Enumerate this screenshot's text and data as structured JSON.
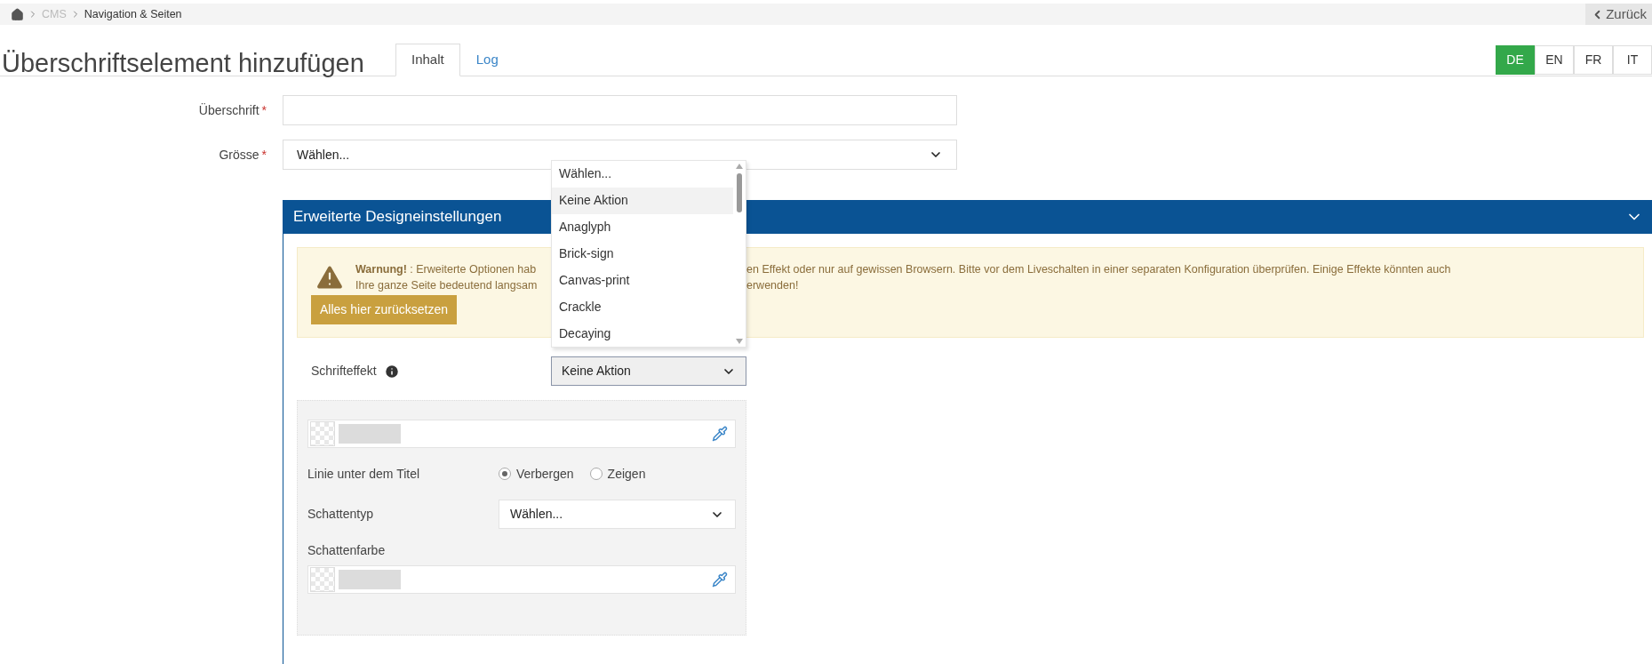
{
  "breadcrumb": {
    "items": [
      {
        "label": "CMS",
        "current": false
      },
      {
        "label": "Navigation & Seiten",
        "current": true
      }
    ],
    "back": "Zurück"
  },
  "title": "Überschriftselement hinzufügen",
  "tabs": [
    {
      "label": "Inhalt",
      "selected": true
    },
    {
      "label": "Log",
      "selected": false
    }
  ],
  "languages": [
    {
      "label": "DE",
      "selected": true
    },
    {
      "label": "EN",
      "selected": false
    },
    {
      "label": "FR",
      "selected": false
    },
    {
      "label": "IT",
      "selected": false
    }
  ],
  "fields": [
    {
      "kind": "text",
      "label": "Überschrift",
      "required_mark": "*"
    },
    {
      "kind": "select",
      "label": "Grösse",
      "required_mark": "*",
      "value": "Wählen..."
    }
  ],
  "panel": {
    "title": "Erweiterte Designeinstellungen",
    "expanded": true,
    "warning": {
      "lines": [
        {
          "left": "**Warnung!** : Erweiterte Optionen hab",
          "right": "en Effekt oder nur auf gewissen Browsern. Bitte vor dem Liveschalten in einer separaten Konfiguration überprüfen. Einige Effekte könnten auch"
        },
        {
          "left": "Ihre ganze Seite bedeutend langsam",
          "right": "erwenden!"
        }
      ],
      "button": "Alles hier zurücksetzen"
    },
    "font_effect": {
      "label": "Schrifteffekt",
      "value": "Keine Aktion",
      "options": [
        {
          "label": "Wählen...",
          "selected": false
        },
        {
          "label": "Keine Aktion",
          "selected": true
        },
        {
          "label": "Anaglyph",
          "selected": false
        },
        {
          "label": "Brick-sign",
          "selected": false
        },
        {
          "label": "Canvas-print",
          "selected": false
        },
        {
          "label": "Crackle",
          "selected": false
        },
        {
          "label": "Decaying",
          "selected": false
        }
      ]
    },
    "settings": [
      {
        "kind": "color"
      },
      {
        "kind": "radio",
        "label": "Linie unter dem Titel",
        "options": [
          {
            "label": "Verbergen",
            "selected": true
          },
          {
            "label": "Zeigen",
            "selected": false
          }
        ]
      },
      {
        "kind": "select",
        "label": "Schattentyp",
        "value": "Wählen..."
      },
      {
        "kind": "color",
        "label": "Schattenfarbe"
      }
    ]
  }
}
